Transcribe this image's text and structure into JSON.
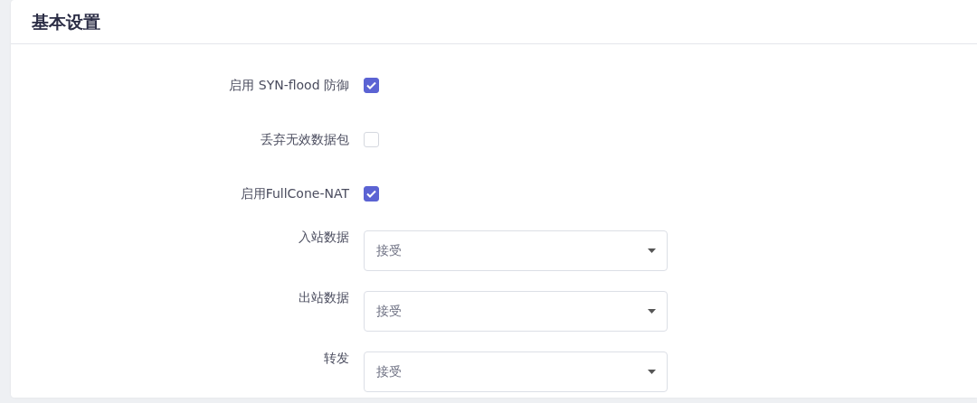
{
  "card": {
    "title": "基本设置"
  },
  "rows": [
    {
      "kind": "checkbox",
      "label": "启用 SYN-flood 防御",
      "checked": true
    },
    {
      "kind": "checkbox",
      "label": "丢弃无效数据包",
      "checked": false
    },
    {
      "kind": "checkbox",
      "label": "启用FullCone-NAT",
      "checked": true
    },
    {
      "kind": "select",
      "label": "入站数据",
      "value": "接受"
    },
    {
      "kind": "select",
      "label": "出站数据",
      "value": "接受"
    },
    {
      "kind": "select",
      "label": "转发",
      "value": "接受"
    }
  ]
}
